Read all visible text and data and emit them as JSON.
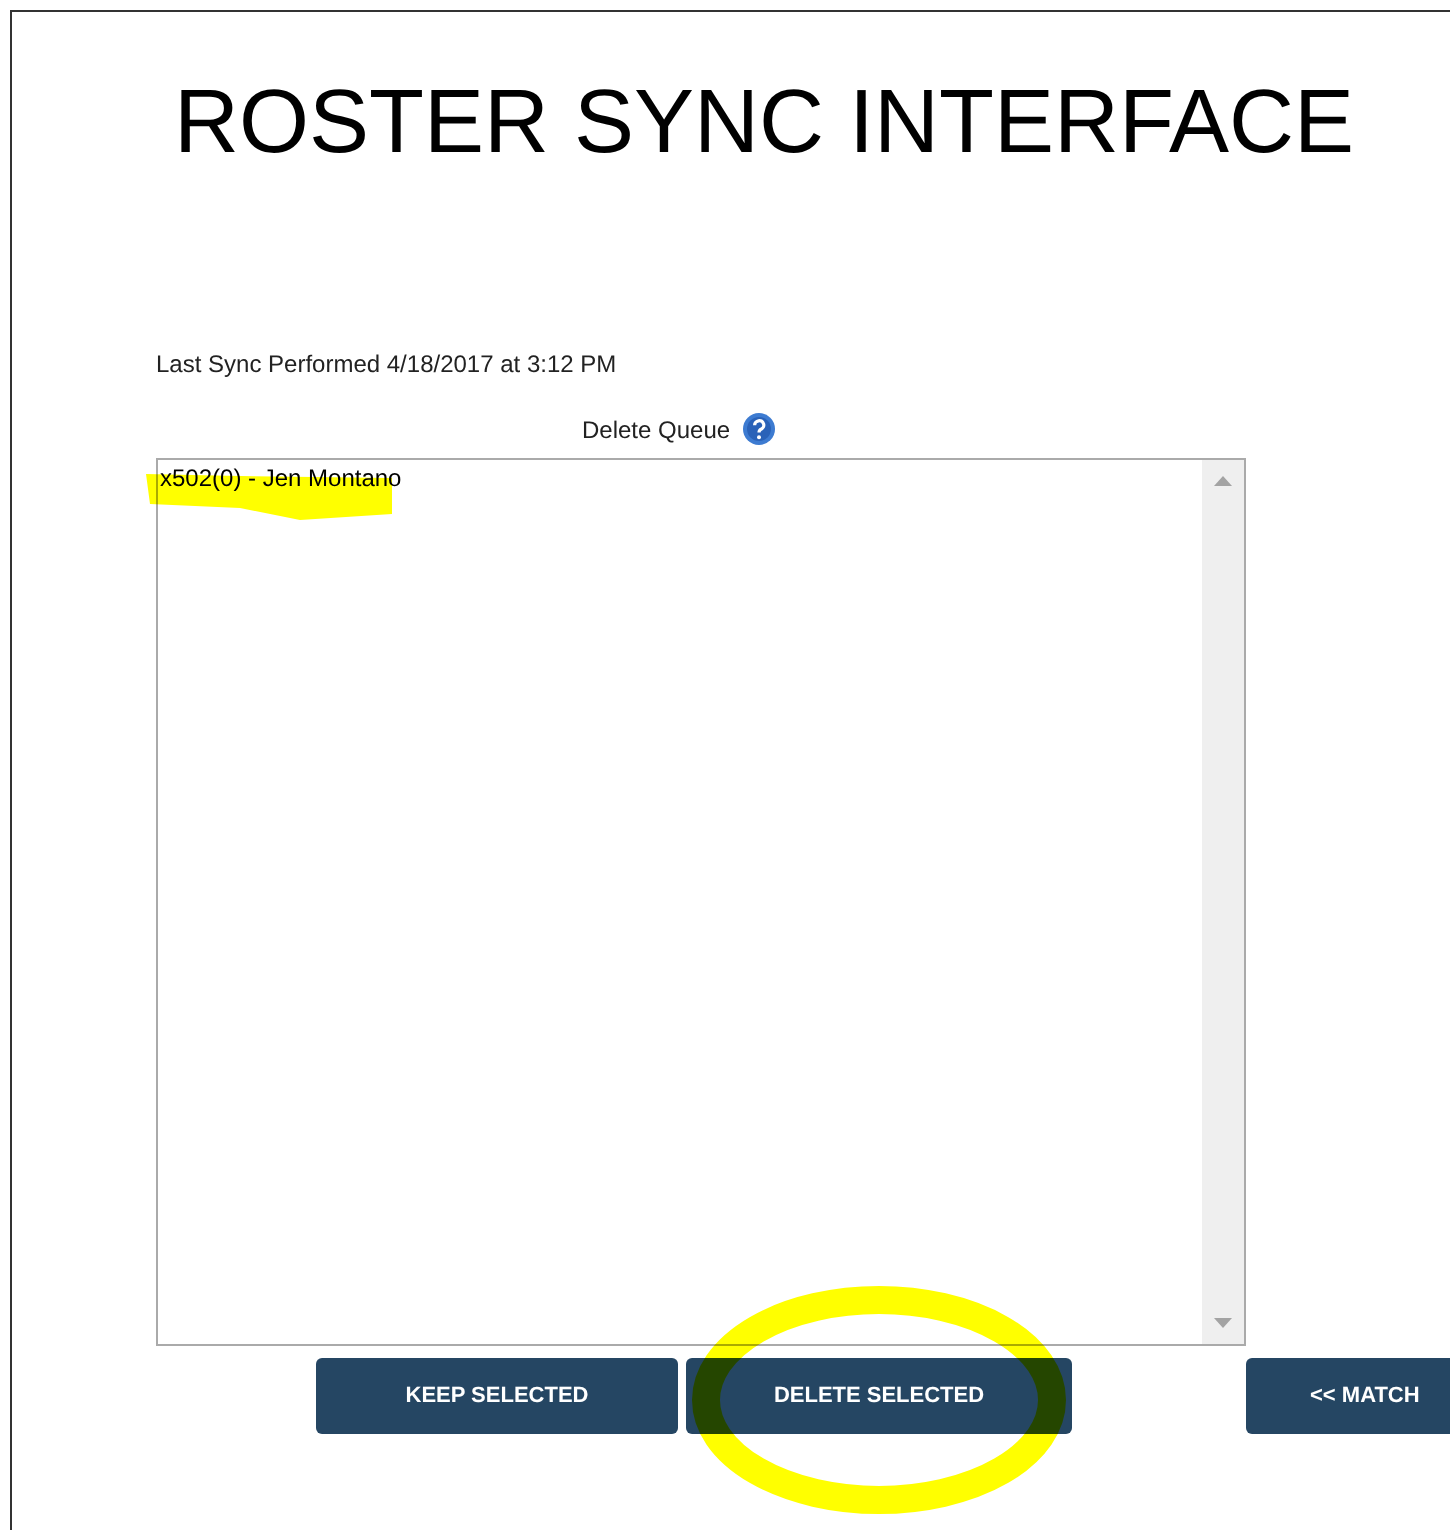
{
  "title": "ROSTER SYNC INTERFACE",
  "last_sync": "Last Sync Performed 4/18/2017 at 3:12 PM",
  "delete_queue": {
    "label": "Delete Queue",
    "items": [
      {
        "text": "x502(0) - Jen Montano",
        "highlighted": true
      }
    ]
  },
  "buttons": [
    {
      "label": "KEEP SELECTED",
      "circled": false
    },
    {
      "label": "DELETE SELECTED",
      "circled": true
    },
    {
      "label": "<< MATCH",
      "circled": false
    }
  ]
}
